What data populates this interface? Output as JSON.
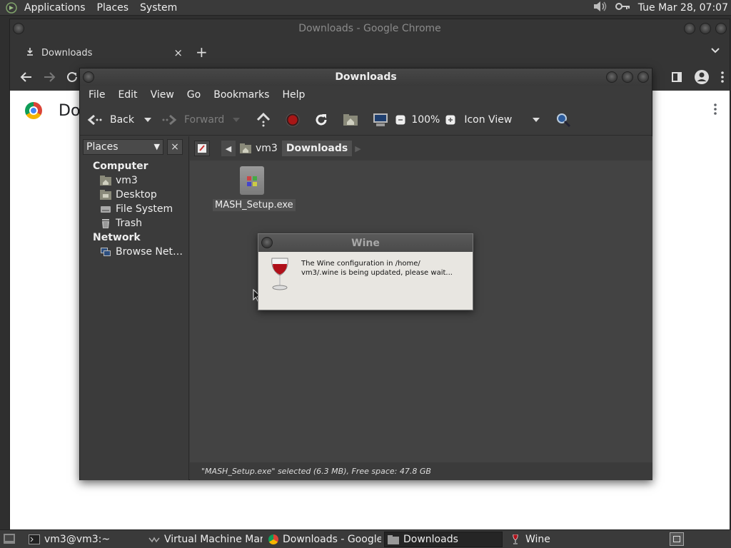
{
  "top_panel": {
    "menus": [
      "Applications",
      "Places",
      "System"
    ],
    "clock": "Tue Mar 28, 07:07",
    "icons": [
      "gnome-foot-icon",
      "volume-icon",
      "network-key-icon"
    ]
  },
  "chrome": {
    "window_title": "Downloads - Google Chrome",
    "tab_label": "Downloads",
    "tab_close": "×",
    "new_tab": "+",
    "page_title": "Downloads"
  },
  "nautilus": {
    "window_title": "Downloads",
    "menu": [
      "File",
      "Edit",
      "View",
      "Go",
      "Bookmarks",
      "Help"
    ],
    "toolbar": {
      "back": "Back",
      "forward": "Forward",
      "zoom": "100%",
      "view_mode": "Icon View"
    },
    "sidebar": {
      "combo": "Places",
      "close": "×",
      "sections": [
        {
          "title": "Computer",
          "items": [
            "vm3",
            "Desktop",
            "File System",
            "Trash"
          ]
        },
        {
          "title": "Network",
          "items": [
            "Browse Net…"
          ]
        }
      ]
    },
    "pathbar": {
      "crumbs": [
        "vm3",
        "Downloads"
      ]
    },
    "files": [
      {
        "name": "MASH_Setup.exe"
      }
    ],
    "status": "\"MASH_Setup.exe\" selected (6.3 MB), Free space: 47.8 GB"
  },
  "wine_dialog": {
    "title": "Wine",
    "message": "The Wine configuration in /home/\nvm3/.wine is being updated, please wait..."
  },
  "taskbar": {
    "tasks": [
      {
        "label": "vm3@vm3:~",
        "icon": "terminal-icon"
      },
      {
        "label": "Virtual Machine Man…",
        "icon": "virt-manager-icon"
      },
      {
        "label": "Downloads - Google…",
        "icon": "chrome-icon"
      },
      {
        "label": "Downloads",
        "icon": "folder-icon",
        "active": true
      },
      {
        "label": "Wine",
        "icon": "wine-glass-icon"
      }
    ]
  },
  "colors": {
    "panel_bg": "#3a3a3a",
    "window_bg": "#3b3b3b",
    "content_bg": "#434343",
    "wine_red": "#b0101a"
  }
}
